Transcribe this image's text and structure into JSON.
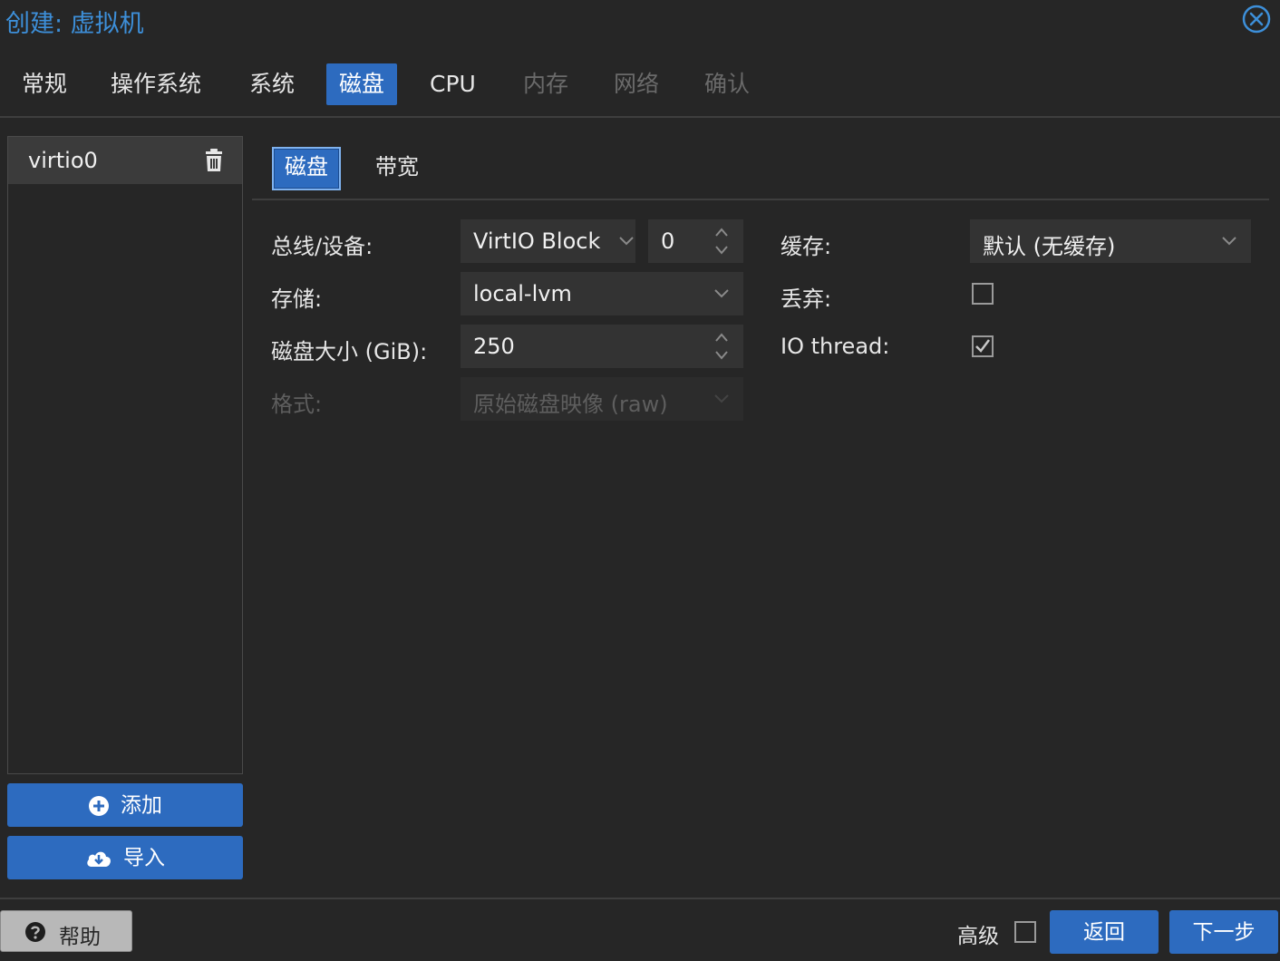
{
  "window": {
    "title": "创建: 虚拟机"
  },
  "wizard_tabs": [
    {
      "label": "常规",
      "state": "normal"
    },
    {
      "label": "操作系统",
      "state": "normal"
    },
    {
      "label": "系统",
      "state": "normal"
    },
    {
      "label": "磁盘",
      "state": "active"
    },
    {
      "label": "CPU",
      "state": "normal"
    },
    {
      "label": "内存",
      "state": "disabled"
    },
    {
      "label": "网络",
      "state": "disabled"
    },
    {
      "label": "确认",
      "state": "disabled"
    }
  ],
  "disk_list": {
    "items": [
      {
        "label": "virtio0",
        "icon": "trash-icon"
      }
    ],
    "add_button": {
      "label": "添加",
      "icon": "plus-circle-icon"
    },
    "import_button": {
      "label": "导入",
      "icon": "cloud-download-icon"
    }
  },
  "sub_tabs": [
    {
      "label": "磁盘",
      "active": true
    },
    {
      "label": "带宽",
      "active": false
    }
  ],
  "form": {
    "bus_device": {
      "label": "总线/设备:",
      "bus": "VirtIO Block",
      "device": "0"
    },
    "storage": {
      "label": "存储:",
      "value": "local-lvm"
    },
    "disk_size": {
      "label": "磁盘大小 (GiB):",
      "value": "250"
    },
    "format": {
      "label": "格式:",
      "value": "原始磁盘映像 (raw)",
      "disabled": true
    },
    "cache": {
      "label": "缓存:",
      "value": "默认 (无缓存)"
    },
    "discard": {
      "label": "丢弃:",
      "checked": false
    },
    "io_thread": {
      "label": "IO thread:",
      "checked": true
    }
  },
  "footer": {
    "help_label": "帮助",
    "advanced_label": "高级",
    "advanced_checked": false,
    "back_label": "返回",
    "next_label": "下一步"
  },
  "colors": {
    "background": "#262626",
    "accent": "#2d6bbf",
    "title": "#3d8fd9",
    "field": "#333333"
  }
}
